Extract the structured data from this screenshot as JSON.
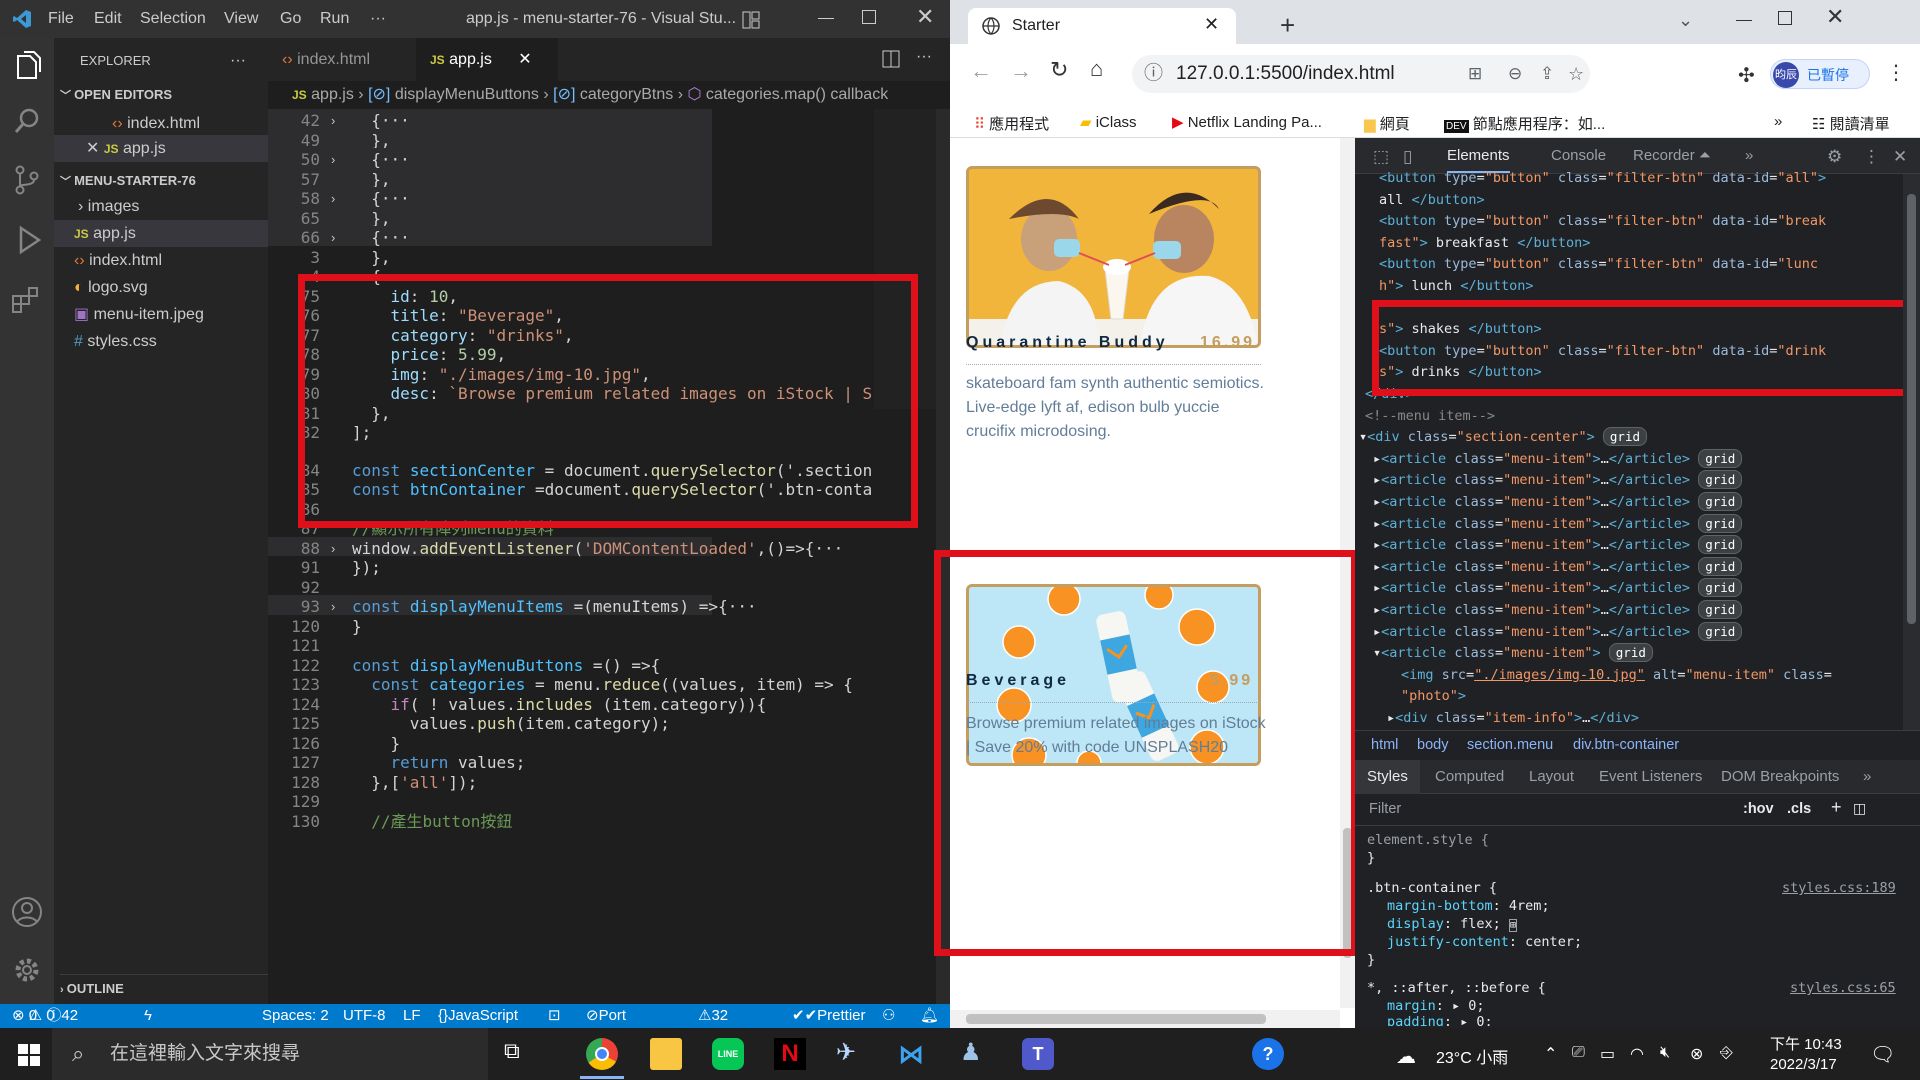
{
  "vscode": {
    "window_title": "app.js - menu-starter-76 - Visual Stu...",
    "menu": [
      "File",
      "Edit",
      "Selection",
      "View",
      "Go",
      "Run",
      "···"
    ],
    "sidebar": {
      "title": "EXPLORER",
      "open_editors_label": "OPEN EDITORS",
      "open_editors": [
        {
          "name": "index.html",
          "icon": "html-icon"
        },
        {
          "name": "app.js",
          "icon": "js-icon",
          "close": "✕"
        }
      ],
      "folder_label": "MENU-STARTER-76",
      "files": [
        {
          "name": "images",
          "icon": "folder"
        },
        {
          "name": "app.js",
          "icon": "js-icon"
        },
        {
          "name": "index.html",
          "icon": "html-icon"
        },
        {
          "name": "logo.svg",
          "icon": "svg-icon"
        },
        {
          "name": "menu-item.jpeg",
          "icon": "image-icon"
        },
        {
          "name": "styles.css",
          "icon": "css-icon"
        }
      ],
      "outline_label": "OUTLINE"
    },
    "tabs": [
      {
        "label": "index.html"
      },
      {
        "label": "app.js",
        "close": "✕"
      }
    ],
    "breadcrumb": [
      "app.js",
      "displayMenuButtons",
      "categoryBtns",
      "categories.map() callback"
    ],
    "editor": {
      "line_numbers": [
        "42",
        "49",
        "50",
        "57",
        "58",
        "65",
        "66",
        "3",
        "4",
        "75",
        "76",
        "77",
        "78",
        "79",
        "80",
        "81",
        "82",
        "84",
        "85",
        "86",
        "87",
        "88",
        "91",
        "92",
        "93",
        "120",
        "121",
        "122",
        "123",
        "124",
        "125",
        "126",
        "127",
        "128",
        "129",
        "130"
      ],
      "code": [
        "  {···",
        "  },",
        "  {···",
        "  },",
        "  {···",
        "  },",
        "  {···",
        "  },",
        "  {",
        "    id: 10,",
        "    title: \"Beverage\",",
        "    category: \"drinks\",",
        "    price: 5.99,",
        "    img: \"./images/img-10.jpg\",",
        "    desc: `Browse premium related images on iStock | S",
        "  },",
        "];",
        "const sectionCenter = document.querySelector('.section",
        "const btnContainer =document.querySelector('.btn-conta",
        "",
        "//顯示所有陣列menu的資料",
        "window.addEventListener('DOMContentLoaded',()=>{···",
        "});",
        "",
        "const displayMenuItems =(menuItems) =>{···",
        "}",
        "",
        "const displayMenuButtons =() =>{",
        "  const categories = menu.reduce((values, item) => {",
        "    if( ! values.includes (item.category)){",
        "      values.push(item.category);",
        "    }",
        "    return values;",
        "  },['all']);",
        "",
        "  //產生button按鈕"
      ]
    },
    "status": {
      "errors": "0",
      "warnings": "0",
      "info": "42",
      "spaces": "Spaces: 2",
      "encoding": "UTF-8",
      "eol": "LF",
      "language": "JavaScript",
      "port": "Port : 5500",
      "spell": "32 Spell",
      "prettier": "Prettier"
    }
  },
  "browser": {
    "tab_title": "Starter",
    "url": "127.0.0.1:5500/index.html",
    "profile_badge": "已暫停",
    "profile_initials": "昀辰",
    "bookmarks": [
      "應用程式",
      "iClass",
      "Netflix Landing Pa...",
      "網頁",
      "節點應用程序：如..."
    ],
    "reading_list": "閱讀清單",
    "page": {
      "items": [
        {
          "title": "Quarantine Buddy",
          "price": "16.99",
          "desc": "skateboard fam synth authentic semiotics. Live-edge lyft af, edison bulb yuccie crucifix microdosing."
        },
        {
          "title": "Beverage",
          "price": "5.99",
          "desc": "Browse premium related images on iStock | Save 20% with code UNSPLASH20"
        }
      ]
    },
    "devtools": {
      "tabs": [
        "Elements",
        "Console",
        "Recorder ⏶",
        "»"
      ],
      "style_tabs": [
        "Styles",
        "Computed",
        "Layout",
        "Event Listeners",
        "DOM Breakpoints",
        "»"
      ],
      "crumbs": [
        "html",
        "body",
        "section.menu",
        "div.btn-container"
      ],
      "filter_placeholder": "Filter",
      "hov": ":hov",
      "cls": ".cls",
      "rules": {
        "element_style": "element.style {",
        "btn_container": ".btn-container {",
        "btn_container_src": "styles.css:189",
        "universal": "*, ::after, ::before {",
        "universal_src": "styles.css:65"
      }
    }
  },
  "taskbar": {
    "search_placeholder": "在這裡輸入文字來搜尋",
    "weather": "23°C 小雨",
    "time": "下午 10:43",
    "date": "2022/3/17"
  }
}
